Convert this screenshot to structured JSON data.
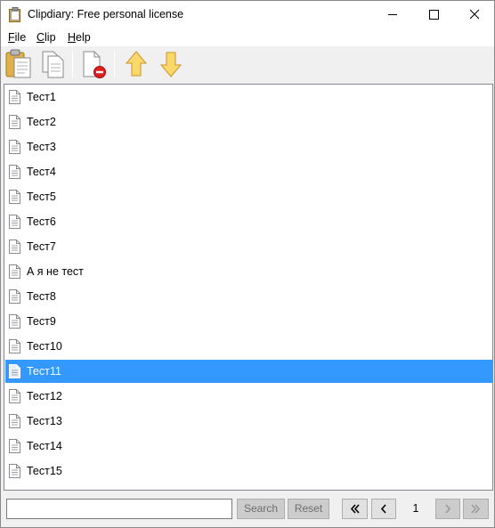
{
  "window": {
    "title": "Clipdiary: Free personal license"
  },
  "menu": [
    {
      "key": "F",
      "rest": "ile"
    },
    {
      "key": "C",
      "rest": "lip"
    },
    {
      "key": "H",
      "rest": "elp"
    }
  ],
  "toolbar": {
    "buttons": [
      "paste-icon",
      "copy-icon",
      "delete-icon",
      "move-up-icon",
      "move-down-icon"
    ]
  },
  "list": {
    "items": [
      "Тест1",
      "Тест2",
      "Тест3",
      "Тест4",
      "Тест5",
      "Тест6",
      "Тест7",
      "А я не тест",
      "Тест8",
      "Тест9",
      "Тест10",
      "Тест11",
      "Тест12",
      "Тест13",
      "Тест14",
      "Тест15"
    ],
    "selected_index": 11
  },
  "search": {
    "value": "",
    "button_label": "Search",
    "reset_label": "Reset"
  },
  "pagination": {
    "first_label": "«",
    "prev_label": "‹",
    "page": "1",
    "next_label": "›",
    "last_label": "»"
  },
  "colors": {
    "selection": "#3399ff",
    "toolbar_bg": "#f0f0f0"
  }
}
